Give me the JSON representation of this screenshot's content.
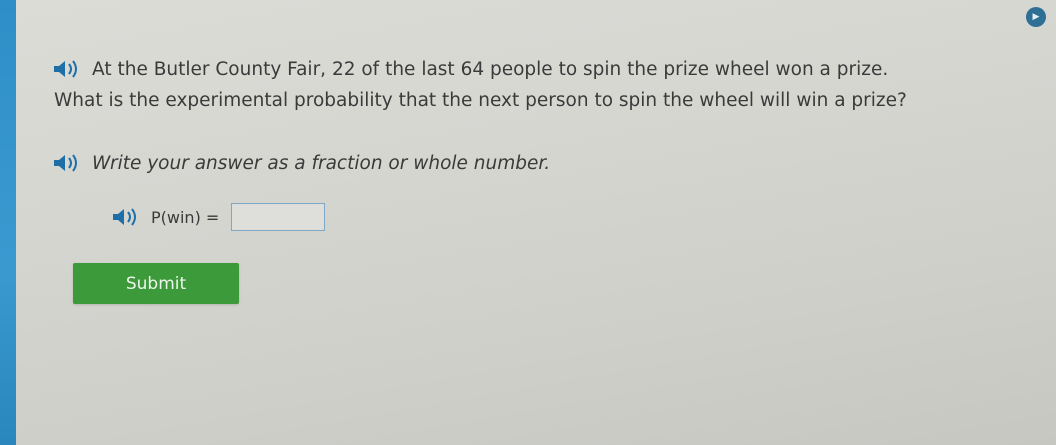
{
  "question": {
    "line1": "At the Butler County Fair, 22 of the last 64 people to spin the prize wheel won a prize.",
    "line2": "What is the experimental probability that the next person to spin the wheel will win a prize?"
  },
  "instruction": "Write your answer as a fraction or whole number.",
  "answer": {
    "label": "P(win) =",
    "value": ""
  },
  "submit_label": "Submit",
  "icons": {
    "audio": "speaker-icon",
    "corner": "play-icon"
  },
  "colors": {
    "submit": "#3d9a3a",
    "accent_bar": "#2e8ec7"
  }
}
